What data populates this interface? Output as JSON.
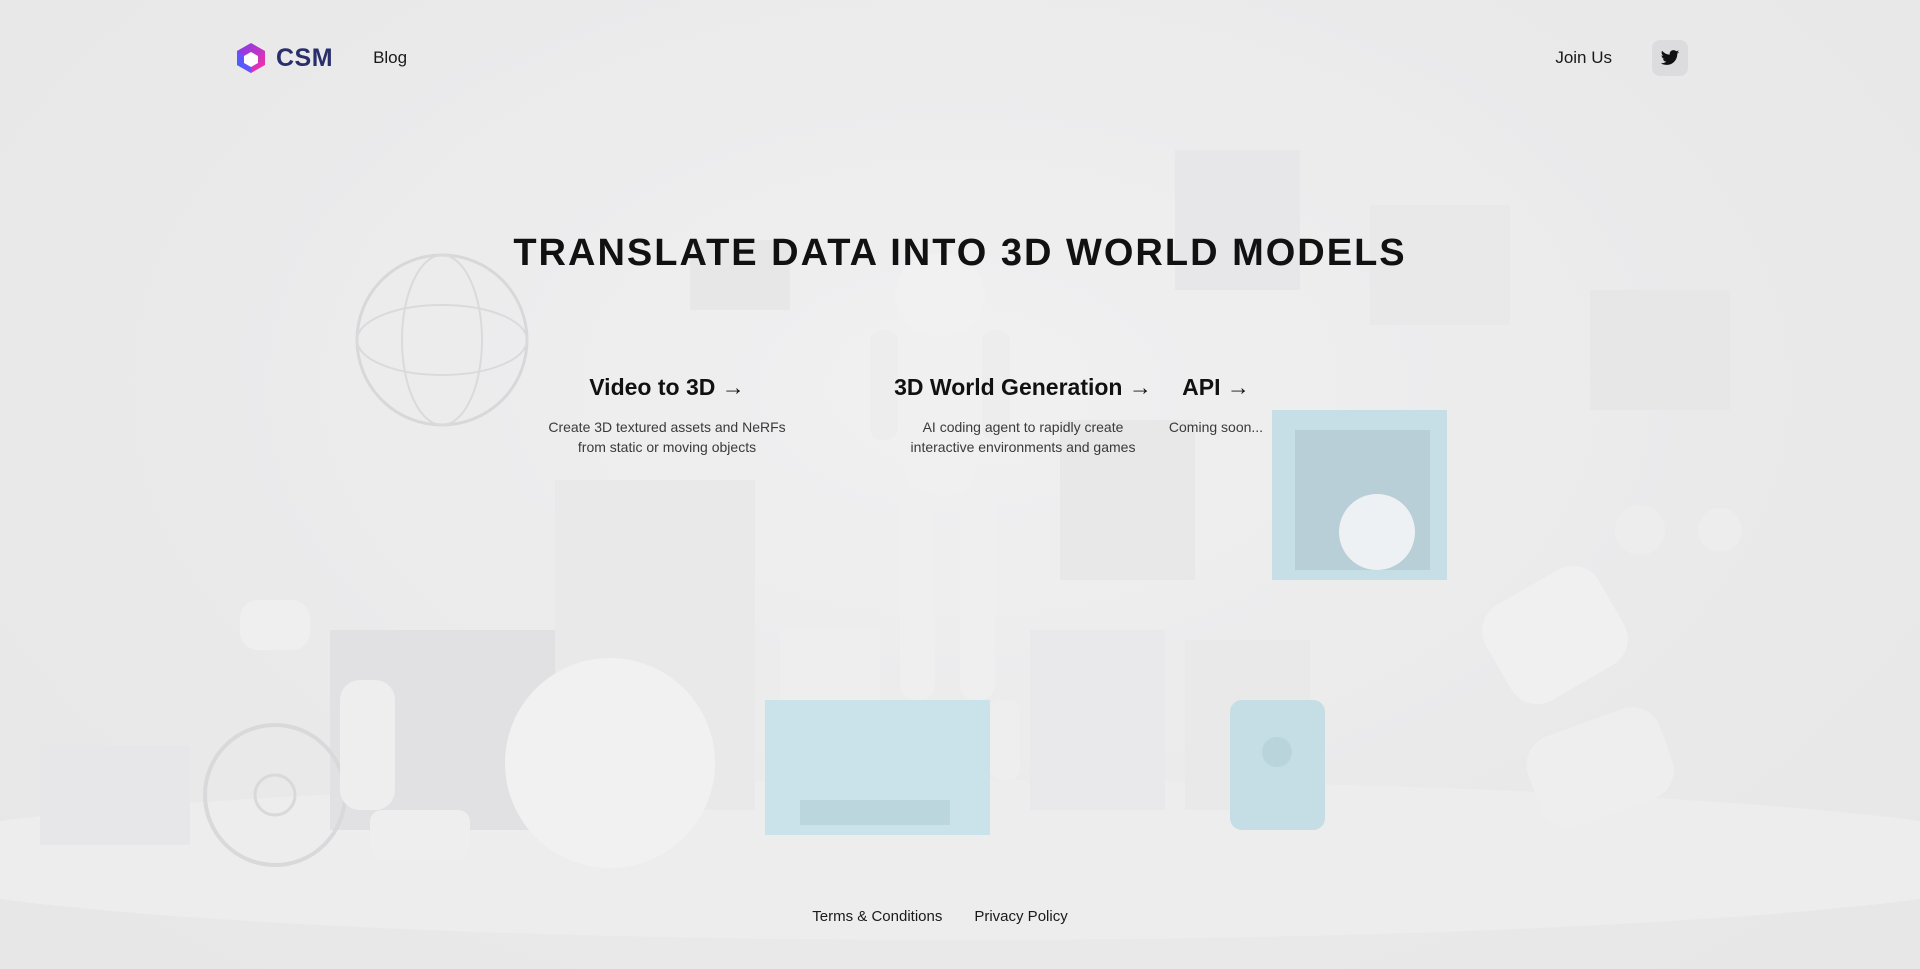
{
  "header": {
    "brand": "CSM",
    "nav_blog": "Blog",
    "join_us": "Join Us",
    "twitter_icon": "twitter-bird-icon"
  },
  "hero": {
    "title": "TRANSLATE DATA INTO 3D WORLD MODELS"
  },
  "features": [
    {
      "title": "Video to 3D →",
      "desc_line1": "Create 3D textured assets and NeRFs",
      "desc_line2": "from static or moving objects"
    },
    {
      "title": "3D World Generation →",
      "desc_line1": "AI coding agent to rapidly create",
      "desc_line2": "interactive environments and games"
    },
    {
      "title": "API →",
      "desc_line1": "Coming soon..."
    }
  ],
  "footer": {
    "terms": "Terms & Conditions",
    "privacy": "Privacy Policy"
  },
  "colors": {
    "background": "#e9e9ea",
    "brand_text": "#2a2f6b",
    "accent_blue": "#b7dce6",
    "logo_gradient_start": "#7a3cf0",
    "logo_gradient_end": "#ff2fa0"
  }
}
